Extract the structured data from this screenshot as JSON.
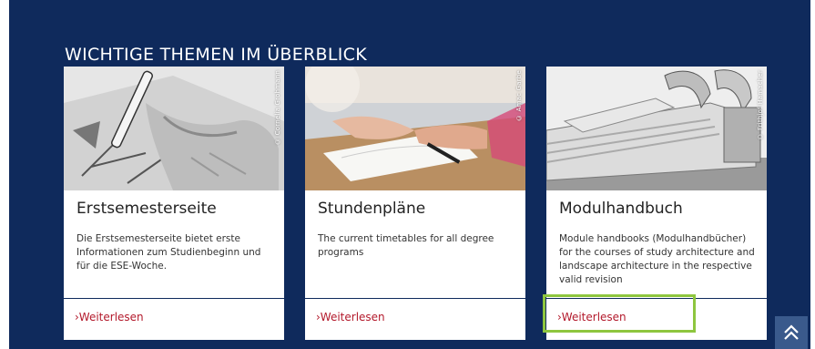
{
  "section": {
    "title": "WICHTIGE THEMEN IM ÜBERBLICK"
  },
  "cards": [
    {
      "credit": "© Cornelia Grohmann",
      "title": "Erstsemesterseite",
      "description": "Die Erstsemesterseite bietet erste Informationen zum Studienbeginn und für die ESE-Woche.",
      "link": "›Weiterlesen"
    },
    {
      "credit": "© Amac Garbe",
      "title": "Stundenpläne",
      "description": "The current timetables for all degree programs",
      "link": "›Weiterlesen"
    },
    {
      "credit": "© Frithjof Hamacher",
      "title": "Modulhandbuch",
      "description": "Module handbooks (Modulhandbücher) for the courses of study architecture and landscape architecture in the respective valid revision",
      "link": "›Weiterlesen"
    }
  ],
  "colors": {
    "section_bg": "#0f2a5c",
    "link": "#b3192b",
    "highlight": "#8ec63f"
  },
  "icons": {
    "scroll_top": "double-chevron-up-icon"
  }
}
